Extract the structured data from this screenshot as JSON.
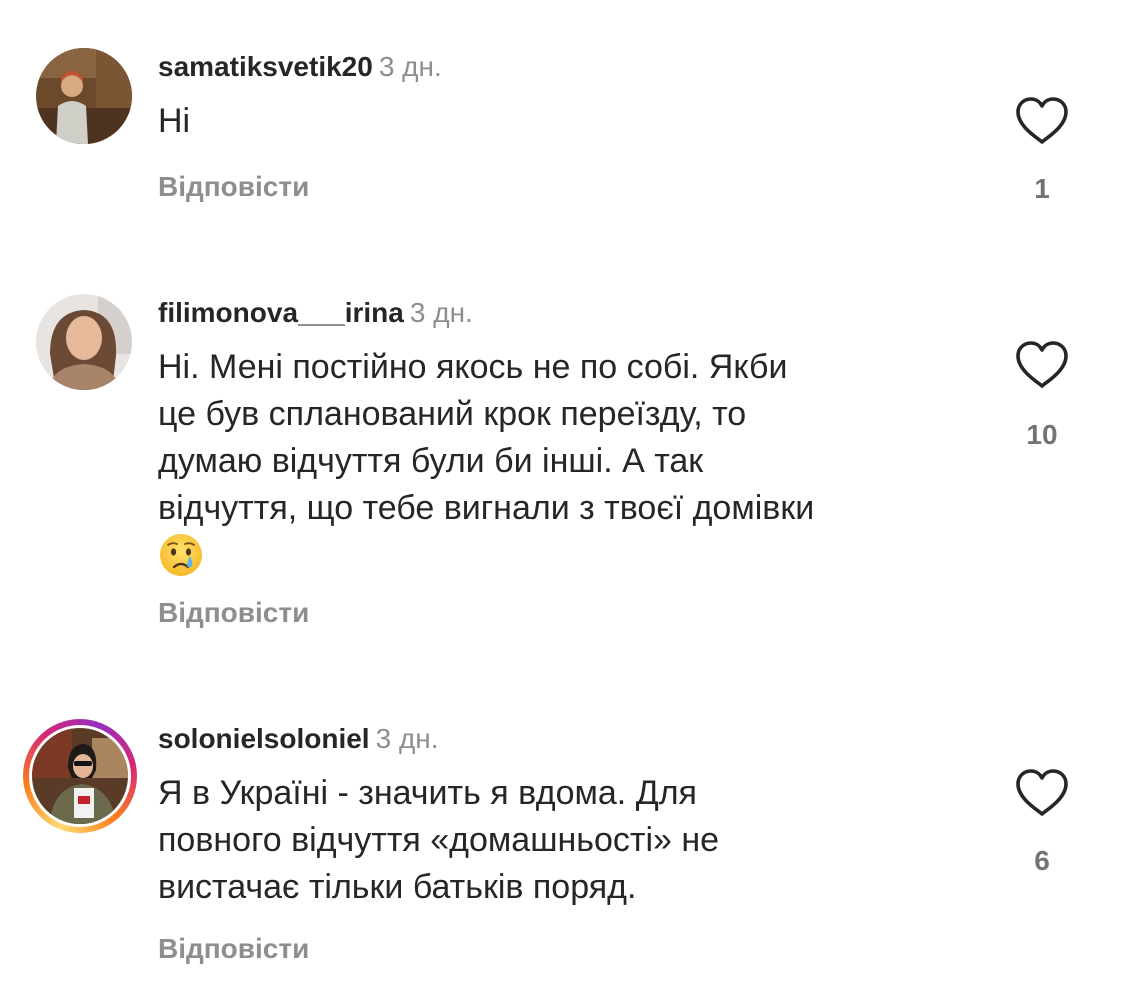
{
  "comments": [
    {
      "username": "samatiksvetik20",
      "time": "3 дн.",
      "text": "Ні",
      "reply_label": "Відповісти",
      "likes": "1"
    },
    {
      "username": "filimonova___irina",
      "time": "3 дн.",
      "text_lines": [
        "Ні. Мені постійно якось не по собі. Якби",
        "це був спланований крок переїзду, то",
        "думаю відчуття були би інші. А так",
        "відчуття, що тебе вигнали з твоєї домівки"
      ],
      "emoji": "crying-face-emoji",
      "reply_label": "Відповісти",
      "likes": "10"
    },
    {
      "username": "solonielsoloniel",
      "time": "3 дн.",
      "text_lines": [
        "Я в Україні - значить я вдома. Для",
        "повного відчуття «домашньості» не",
        "вистачає тільки батьків поряд."
      ],
      "has_story_ring": true,
      "reply_label": "Відповісти",
      "likes": "6"
    }
  ],
  "icons": {
    "like": "heart-outline-icon"
  },
  "colors": {
    "text": "#262626",
    "secondary": "#8e8e8e",
    "story_ring": [
      "#feda75",
      "#fa7e1e",
      "#d62976",
      "#962fbf"
    ]
  }
}
